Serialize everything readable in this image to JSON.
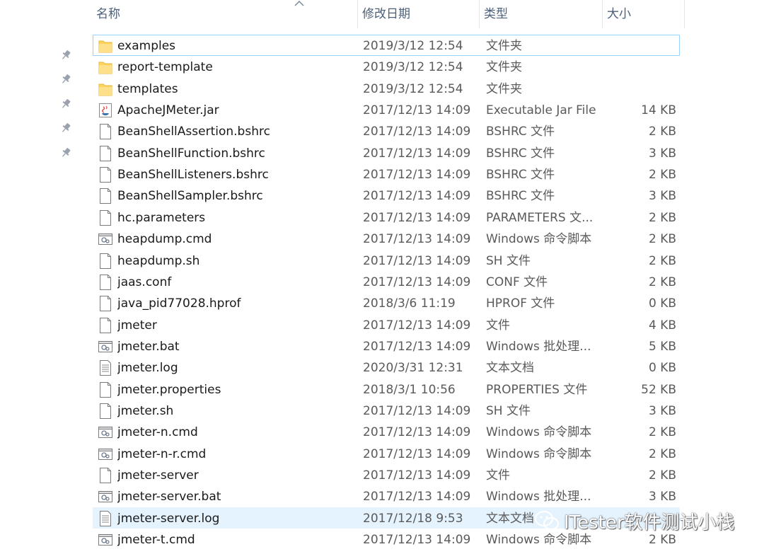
{
  "columns": {
    "name": "名称",
    "date": "修改日期",
    "type": "类型",
    "size": "大小"
  },
  "quick_access_pins": 5,
  "files": [
    {
      "name": "examples",
      "date": "2019/3/12 12:54",
      "type": "文件夹",
      "size": "",
      "icon": "folder-icon",
      "state": "selected"
    },
    {
      "name": "report-template",
      "date": "2019/3/12 12:54",
      "type": "文件夹",
      "size": "",
      "icon": "folder-icon"
    },
    {
      "name": "templates",
      "date": "2019/3/12 12:54",
      "type": "文件夹",
      "size": "",
      "icon": "folder-icon"
    },
    {
      "name": "ApacheJMeter.jar",
      "date": "2017/12/13 14:09",
      "type": "Executable Jar File",
      "size": "14 KB",
      "icon": "java-jar-icon"
    },
    {
      "name": "BeanShellAssertion.bshrc",
      "date": "2017/12/13 14:09",
      "type": "BSHRC 文件",
      "size": "2 KB",
      "icon": "file-icon"
    },
    {
      "name": "BeanShellFunction.bshrc",
      "date": "2017/12/13 14:09",
      "type": "BSHRC 文件",
      "size": "3 KB",
      "icon": "file-icon"
    },
    {
      "name": "BeanShellListeners.bshrc",
      "date": "2017/12/13 14:09",
      "type": "BSHRC 文件",
      "size": "2 KB",
      "icon": "file-icon"
    },
    {
      "name": "BeanShellSampler.bshrc",
      "date": "2017/12/13 14:09",
      "type": "BSHRC 文件",
      "size": "3 KB",
      "icon": "file-icon"
    },
    {
      "name": "hc.parameters",
      "date": "2017/12/13 14:09",
      "type": "PARAMETERS 文...",
      "size": "2 KB",
      "icon": "file-icon"
    },
    {
      "name": "heapdump.cmd",
      "date": "2017/12/13 14:09",
      "type": "Windows 命令脚本",
      "size": "2 KB",
      "icon": "script-icon"
    },
    {
      "name": "heapdump.sh",
      "date": "2017/12/13 14:09",
      "type": "SH 文件",
      "size": "2 KB",
      "icon": "file-icon"
    },
    {
      "name": "jaas.conf",
      "date": "2017/12/13 14:09",
      "type": "CONF 文件",
      "size": "2 KB",
      "icon": "file-icon"
    },
    {
      "name": "java_pid77028.hprof",
      "date": "2018/3/6 11:19",
      "type": "HPROF 文件",
      "size": "0 KB",
      "icon": "file-icon"
    },
    {
      "name": "jmeter",
      "date": "2017/12/13 14:09",
      "type": "文件",
      "size": "4 KB",
      "icon": "file-icon"
    },
    {
      "name": "jmeter.bat",
      "date": "2017/12/13 14:09",
      "type": "Windows 批处理...",
      "size": "5 KB",
      "icon": "script-icon"
    },
    {
      "name": "jmeter.log",
      "date": "2020/3/31 12:31",
      "type": "文本文档",
      "size": "0 KB",
      "icon": "text-file-icon"
    },
    {
      "name": "jmeter.properties",
      "date": "2018/3/1 10:56",
      "type": "PROPERTIES 文件",
      "size": "52 KB",
      "icon": "file-icon"
    },
    {
      "name": "jmeter.sh",
      "date": "2017/12/13 14:09",
      "type": "SH 文件",
      "size": "3 KB",
      "icon": "file-icon"
    },
    {
      "name": "jmeter-n.cmd",
      "date": "2017/12/13 14:09",
      "type": "Windows 命令脚本",
      "size": "2 KB",
      "icon": "script-icon"
    },
    {
      "name": "jmeter-n-r.cmd",
      "date": "2017/12/13 14:09",
      "type": "Windows 命令脚本",
      "size": "2 KB",
      "icon": "script-icon"
    },
    {
      "name": "jmeter-server",
      "date": "2017/12/13 14:09",
      "type": "文件",
      "size": "2 KB",
      "icon": "file-icon"
    },
    {
      "name": "jmeter-server.bat",
      "date": "2017/12/13 14:09",
      "type": "Windows 批处理...",
      "size": "3 KB",
      "icon": "script-icon"
    },
    {
      "name": "jmeter-server.log",
      "date": "2017/12/18 9:53",
      "type": "文本文档",
      "size": "",
      "icon": "text-file-icon",
      "state": "hovered"
    },
    {
      "name": "jmeter-t.cmd",
      "date": "2017/12/13 14:09",
      "type": "Windows 命令脚本",
      "size": "2 KB",
      "icon": "script-icon"
    }
  ],
  "watermark": {
    "text": "ITester软件测试小栈",
    "icon": "wechat-logo-icon"
  },
  "colors": {
    "header_text": "#4c607a",
    "selected_border": "#99d1ff",
    "hover_background": "#e5f3ff",
    "folder": "#ffd65c"
  }
}
